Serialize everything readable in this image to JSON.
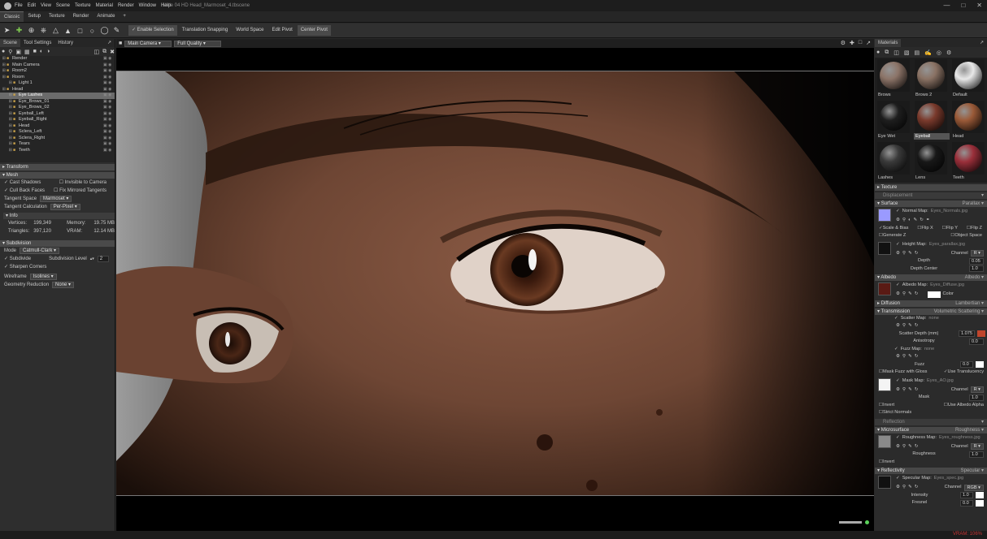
{
  "titlebar": {
    "menu": [
      "File",
      "Edit",
      "View",
      "Scene",
      "Texture",
      "Material",
      "Render",
      "Window",
      "Help"
    ],
    "title": "Male 04 HD Head_Marmoset_4.tbscene"
  },
  "tabs": [
    "Classic",
    "Setup",
    "Texture",
    "Render",
    "Animate",
    "+"
  ],
  "toolbar": {
    "buttons": [
      "Enable Selection",
      "Translation Snapping",
      "World Space",
      "Edit Pivot",
      "Center Pivot"
    ]
  },
  "left": {
    "tabs": [
      "Scene",
      "Tool Settings",
      "History"
    ],
    "tree": [
      {
        "name": "Render",
        "indent": 1
      },
      {
        "name": "Main Camera",
        "indent": 1
      },
      {
        "name": "Room2",
        "indent": 1
      },
      {
        "name": "Room",
        "indent": 1
      },
      {
        "name": "Light 1",
        "indent": 2
      },
      {
        "name": "Head",
        "indent": 1
      },
      {
        "name": "Eye Lashes",
        "indent": 2,
        "selected": true
      },
      {
        "name": "Eye_Brows_01",
        "indent": 2
      },
      {
        "name": "Eye_Brows_02",
        "indent": 2
      },
      {
        "name": "Eyeball_Left",
        "indent": 2
      },
      {
        "name": "Eyeball_Right",
        "indent": 2
      },
      {
        "name": "Head",
        "indent": 2
      },
      {
        "name": "Sclera_Left",
        "indent": 2
      },
      {
        "name": "Sclera_Right",
        "indent": 2
      },
      {
        "name": "Tears",
        "indent": 2
      },
      {
        "name": "Teeth",
        "indent": 2
      }
    ],
    "transform_label": "Transform",
    "mesh_label": "Mesh",
    "cast_shadows": "Cast Shadows",
    "invisible_to_camera": "Invisible to Camera",
    "cull_back_faces": "Cull Back Faces",
    "fix_mirrored": "Fix Mirrored Tangents",
    "tangent_space_label": "Tangent Space",
    "tangent_space_value": "Marmoset",
    "tangent_calc_label": "Tangent Calculation",
    "tangent_calc_value": "Per-Pixel",
    "info_label": "Info",
    "vertices_label": "Vertices:",
    "vertices_value": "199,349",
    "memory_label": "Memory:",
    "memory_value": "19.75 MB",
    "triangles_label": "Triangles:",
    "triangles_value": "397,120",
    "vram_label": "VRAM:",
    "vram_value": "12.14 MB",
    "subdivision_label": "Subdivision",
    "mode_label": "Mode",
    "mode_value": "Catmull-Clark",
    "subdivide_label": "Subdivide",
    "subdiv_level_label": "Subdivision Level",
    "subdiv_level_value": "2",
    "sharpen_corners": "Sharpen Corners",
    "wireframe_label": "Wireframe",
    "wireframe_value": "Isolines",
    "geom_reduction_label": "Geometry Reduction",
    "geom_reduction_value": "None"
  },
  "viewport": {
    "camera": "Main Camera",
    "quality": "Full Quality"
  },
  "right": {
    "header": "Materials",
    "materials": [
      {
        "name": "Brows",
        "color": "#8c7468"
      },
      {
        "name": "Brows 2",
        "color": "#8a7264"
      },
      {
        "name": "Default",
        "color": "#e8e8e8"
      },
      {
        "name": "Eye Wet",
        "color": "#1e1e1e"
      },
      {
        "name": "Eyeball",
        "color": "#7a3a2c",
        "selected": true
      },
      {
        "name": "Head",
        "color": "#9a5a38"
      },
      {
        "name": "Lashes",
        "color": "#3a3a3a"
      },
      {
        "name": "Lens",
        "color": "#181818"
      },
      {
        "name": "Teeth",
        "color": "#9a2f3a"
      }
    ],
    "texture": "Texture",
    "displacement": "Displacement",
    "surface": "Surface",
    "surface_mode": "Parallax",
    "normal_map_label": "Normal Map:",
    "normal_map_file": "Eyes_Normals.jpg",
    "scale_bias": "Scale & Bias",
    "flip_x": "Flip X",
    "flip_y": "Flip Y",
    "flip_z": "Flip Z",
    "generate_z": "Generate Z",
    "object_space": "Object Space",
    "height_map_label": "Height Map:",
    "height_map_file": "Eyes_parallax.jpg",
    "channel_label": "Channel",
    "channel_r": "R",
    "depth_label": "Depth",
    "depth_value": "0.05",
    "depth_center_label": "Depth Center",
    "depth_center_value": "1.0",
    "albedo": "Albedo",
    "albedo_mode": "Albedo",
    "albedo_map_label": "Albedo Map:",
    "albedo_map_file": "Eyes_Diffuse.jpg",
    "color_label": "Color",
    "diffusion": "Diffusion",
    "diffusion_mode": "Lambertian",
    "transmission": "Transmission",
    "transmission_mode": "Volumetric Scattering",
    "scatter_map_label": "Scatter Map:",
    "scatter_map_file": "none",
    "scatter_depth_label": "Scatter Depth (mm)",
    "scatter_depth_value": "1.075",
    "anisotropy_label": "Anisotropy",
    "anisotropy_value": "0.0",
    "fuzz_map_label": "Fuzz Map:",
    "fuzz_map_file": "none",
    "fuzz_label": "Fuzz",
    "fuzz_value": "0.0",
    "mask_fuzz_gloss": "Mask Fuzz with Gloss",
    "use_translucency": "Use Translucency",
    "mask_map_label": "Mask Map:",
    "mask_map_file": "Eyes_AO.jpg",
    "mask_label": "Mask",
    "mask_value": "1.0",
    "invert": "Invert",
    "use_albedo_alpha": "Use Albedo Alpha",
    "strict_normals": "Strict Normals",
    "reflection": "Reflection",
    "microsurface": "Microsurface",
    "microsurface_mode": "Roughness",
    "roughness_map_label": "Roughness Map:",
    "roughness_map_file": "Eyes_roughness.jpg",
    "roughness_label": "Roughness",
    "roughness_value": "1.0",
    "reflectivity": "Reflectivity",
    "reflectivity_mode": "Specular",
    "specular_map_label": "Specular Map:",
    "specular_map_file": "Eyes_spec.jpg",
    "channel_rgb": "RGB",
    "intensity_label": "Intensity",
    "intensity_value": "1.0",
    "fresnel_label": "Fresnel",
    "fresnel_value": "0.0",
    "scatter_color": "#c0452c"
  },
  "status": {
    "vram": "VRAM: 106%"
  }
}
